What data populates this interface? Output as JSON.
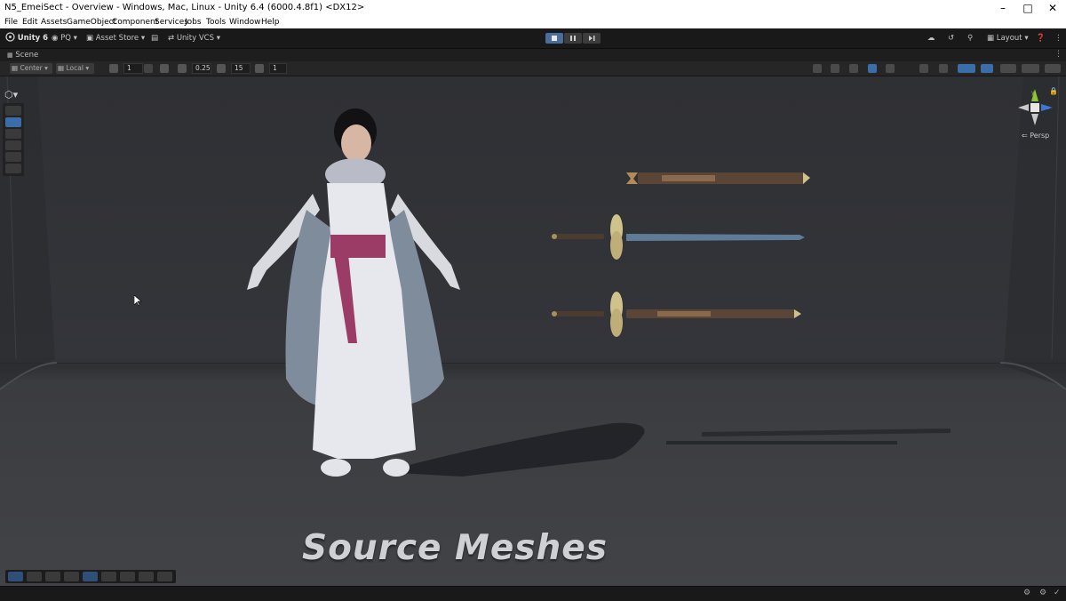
{
  "window": {
    "title": "N5_EmeiSect - Overview - Windows, Mac, Linux - Unity 6.4 (6000.4.8f1) <DX12>",
    "controls": [
      "minimize",
      "maximize",
      "close"
    ]
  },
  "menu": [
    "File",
    "Edit",
    "Assets",
    "GameObject",
    "Component",
    "Services",
    "Jobs",
    "Tools",
    "Window",
    "Help"
  ],
  "toolbar": {
    "unity_label": "Unity 6",
    "account_label": "PQ",
    "asset_store_label": "Asset Store",
    "vcs_label": "Unity VCS",
    "layout_label": "Layout",
    "play_mode": [
      "play",
      "pause",
      "step"
    ],
    "play_active": "play"
  },
  "scene_tab": {
    "label": "Scene"
  },
  "scene_toolbar": {
    "pivot_label": "Center",
    "space_label": "Local",
    "grid_value": "1",
    "snap_move_value": "0.25",
    "snap_rotate_value": "15",
    "snap_scale_value": "1"
  },
  "viewport": {
    "projection_label": "Persp",
    "caption": "Source Meshes",
    "gizmo_axes": [
      "y",
      "z"
    ]
  },
  "colors": {
    "accent": "#3b6ea8",
    "axis_y": "#8ec536",
    "axis_z": "#3d77d6",
    "axis_x": "#c9c9c9"
  }
}
